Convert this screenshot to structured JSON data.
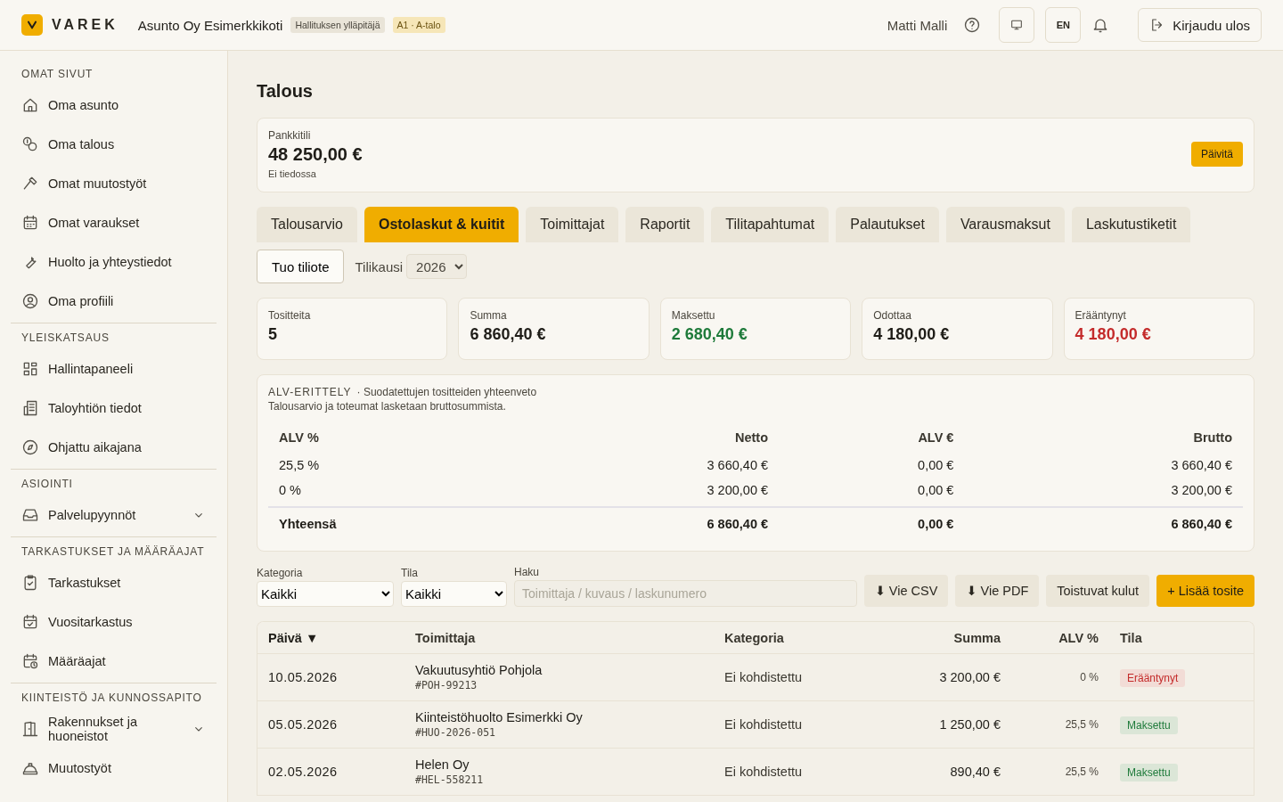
{
  "header": {
    "logo_text": "VAREK",
    "org_name": "Asunto Oy Esimerkkikoti",
    "badges": [
      {
        "label": "Hallituksen ylläpitäjä",
        "kind": "role"
      },
      {
        "label": "A1 · A-talo",
        "kind": "unit"
      }
    ],
    "user_name": "Matti Malli",
    "language": "EN",
    "logout": "Kirjaudu ulos"
  },
  "sidebar": {
    "sections": [
      {
        "title": "OMAT SIVUT",
        "items": [
          {
            "label": "Oma asunto",
            "selected": false
          },
          {
            "label": "Oma talous",
            "selected": false
          },
          {
            "label": "Omat muutostyöt",
            "selected": false
          },
          {
            "label": "Omat varaukset",
            "selected": false
          },
          {
            "label": "Huolto ja yhteystiedot",
            "selected": false
          },
          {
            "label": "Oma profiili",
            "selected": false
          }
        ]
      },
      {
        "title": "YLEISKATSAUS",
        "items": [
          {
            "label": "Hallintapaneeli",
            "selected": false
          },
          {
            "label": "Taloyhtiön tiedot",
            "selected": false
          },
          {
            "label": "Ohjattu aikajana",
            "selected": false
          }
        ]
      },
      {
        "title": "ASIOINTI",
        "items": [
          {
            "label": "Palvelupyynnöt",
            "selected": false,
            "expanded": false
          }
        ]
      },
      {
        "title": "TARKASTUKSET JA MÄÄRÄAJAT",
        "items": [
          {
            "label": "Tarkastukset",
            "selected": false
          },
          {
            "label": "Vuositarkastus",
            "selected": false
          },
          {
            "label": "Määräajat",
            "selected": false
          }
        ]
      },
      {
        "title": "KIINTEISTÖ JA KUNNOSSAPITO",
        "items": [
          {
            "label": "Rakennukset ja huoneistot",
            "selected": false,
            "expanded": false
          },
          {
            "label": "Muutostyöt",
            "selected": false
          }
        ]
      }
    ]
  },
  "page": {
    "title": "Talous",
    "bank": {
      "label": "Pankkitili",
      "amount": "48 250,00 €",
      "note": "Ei tiedossa",
      "button": "Päivitä"
    },
    "tabs": [
      {
        "label": "Talousarvio",
        "selected": false
      },
      {
        "label": "Ostolaskut & kuitit",
        "selected": true
      },
      {
        "label": "Toimittajat",
        "selected": false
      },
      {
        "label": "Raportit",
        "selected": false
      },
      {
        "label": "Tilitapahtumat",
        "selected": false
      },
      {
        "label": "Palautukset",
        "selected": false
      },
      {
        "label": "Varausmaksut",
        "selected": false
      },
      {
        "label": "Laskutustiketit",
        "selected": false
      }
    ],
    "import_button": "Tuo tiliote",
    "period_label": "Tilikausi",
    "period_value": "2026",
    "stats": [
      {
        "label": "Tositteita",
        "value": "5",
        "color": "#1f1d18"
      },
      {
        "label": "Summa",
        "value": "6 860,40 €",
        "color": "#1f1d18"
      },
      {
        "label": "Maksettu",
        "value": "2 680,40 €",
        "color": "#1e7a3a"
      },
      {
        "label": "Odottaa",
        "value": "4 180,00 €",
        "color": "#1f1d18"
      },
      {
        "label": "Erääntynyt",
        "value": "4 180,00 €",
        "color": "#c42b2b"
      }
    ],
    "vat": {
      "title": "ALV-ERITTELY",
      "subtitle": "· Suodatettujen tositteiden yhteenveto",
      "note": "Talousarvio ja toteumat lasketaan bruttosummista.",
      "columns": [
        "ALV %",
        "Netto",
        "ALV €",
        "Brutto"
      ],
      "rows": [
        [
          "25,5 %",
          "3 660,40 €",
          "0,00 €",
          "3 660,40 €"
        ],
        [
          "0 %",
          "3 200,00 €",
          "0,00 €",
          "3 200,00 €"
        ]
      ],
      "total": [
        "Yhteensä",
        "6 860,40 €",
        "0,00 €",
        "6 860,40 €"
      ]
    },
    "filters": {
      "category_label": "Kategoria",
      "category_value": "Kaikki",
      "status_label": "Tila",
      "status_value": "Kaikki",
      "search_label": "Haku",
      "search_placeholder": "Toimittaja / kuvaus / laskunumero"
    },
    "actions": [
      {
        "label": "⬇ Vie CSV",
        "kind": "secondary"
      },
      {
        "label": "⬇ Vie PDF",
        "kind": "secondary"
      },
      {
        "label": "Toistuvat kulut",
        "kind": "secondary"
      },
      {
        "label": "+ Lisää tosite",
        "kind": "primary"
      }
    ],
    "table": {
      "columns": [
        "Päivä ▼",
        "Toimittaja",
        "Kategoria",
        "Summa",
        "ALV %",
        "Tila"
      ],
      "rows": [
        {
          "date": "10.05.2026",
          "supplier": "Vakuutusyhtiö Pohjola",
          "ref": "#POH-99213",
          "category": "Ei kohdistettu",
          "amount": "3 200,00 €",
          "vat": "0 %",
          "status": "Erääntynyt",
          "kind": "overdue"
        },
        {
          "date": "05.05.2026",
          "supplier": "Kiinteistöhuolto Esimerkki Oy",
          "ref": "#HUO-2026-051",
          "category": "Ei kohdistettu",
          "amount": "1 250,00 €",
          "vat": "25,5 %",
          "status": "Maksettu",
          "kind": "paid"
        },
        {
          "date": "02.05.2026",
          "supplier": "Helen Oy",
          "ref": "#HEL-558211",
          "category": "Ei kohdistettu",
          "amount": "890,40 €",
          "vat": "25,5 %",
          "status": "Maksettu",
          "kind": "paid"
        }
      ]
    }
  }
}
